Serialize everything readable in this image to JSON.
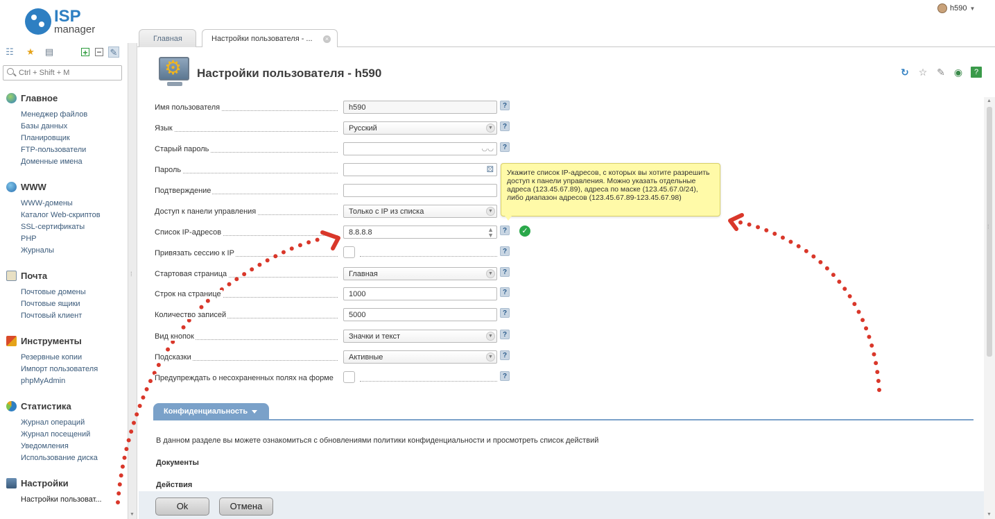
{
  "app": {
    "logo_isp": "ISP",
    "logo_manager": "manager",
    "user_name": "h590"
  },
  "sidebar": {
    "search_placeholder": "Ctrl + Shift + M",
    "sections": [
      {
        "title": "Главное",
        "icon": "home-globe-icon",
        "items": [
          "Менеджер файлов",
          "Базы данных",
          "Планировщик",
          "FTP-пользователи",
          "Доменные имена"
        ]
      },
      {
        "title": "WWW",
        "icon": "globe-icon",
        "items": [
          "WWW-домены",
          "Каталог Web-скриптов",
          "SSL-сертификаты",
          "PHP",
          "Журналы"
        ]
      },
      {
        "title": "Почта",
        "icon": "mail-icon",
        "items": [
          "Почтовые домены",
          "Почтовые ящики",
          "Почтовый клиент"
        ]
      },
      {
        "title": "Инструменты",
        "icon": "tools-icon",
        "items": [
          "Резервные копии",
          "Импорт пользователя",
          "phpMyAdmin"
        ]
      },
      {
        "title": "Статистика",
        "icon": "stats-icon",
        "items": [
          "Журнал операций",
          "Журнал посещений",
          "Уведомления",
          "Использование диска"
        ]
      },
      {
        "title": "Настройки",
        "icon": "settings-icon",
        "items": [
          "Настройки пользоват..."
        ]
      }
    ]
  },
  "tabs": [
    {
      "label": "Главная"
    },
    {
      "label": "Настройки пользователя - ..."
    }
  ],
  "page": {
    "title": "Настройки пользователя - h590"
  },
  "form": {
    "username": {
      "label": "Имя пользователя",
      "value": "h590"
    },
    "language": {
      "label": "Язык",
      "value": "Русский"
    },
    "old_password": {
      "label": "Старый пароль",
      "value": ""
    },
    "password": {
      "label": "Пароль",
      "value": ""
    },
    "confirm": {
      "label": "Подтверждение",
      "value": ""
    },
    "panel_access": {
      "label": "Доступ к панели управления",
      "value": "Только с IP из списка"
    },
    "ip_list": {
      "label": "Список IP-адресов",
      "value": "8.8.8.8"
    },
    "bind_session": {
      "label": "Привязать сессию к IP",
      "checked": false
    },
    "start_page": {
      "label": "Стартовая страница",
      "value": "Главная"
    },
    "rows_per_page": {
      "label": "Строк на странице",
      "value": "1000"
    },
    "records_count": {
      "label": "Количество записей",
      "value": "5000"
    },
    "button_view": {
      "label": "Вид кнопок",
      "value": "Значки и текст"
    },
    "hints": {
      "label": "Подсказки",
      "value": "Активные"
    },
    "warn_unsaved": {
      "label": "Предупреждать о несохраненных полях на форме",
      "checked": false
    }
  },
  "tooltip": {
    "text": "Укажите список IP-адресов, с которых вы хотите разрешить доступ к панели управления. Можно указать отдельные адреса (123.45.67.89), адреса по маске (123.45.67.0/24), либо диапазон адресов (123.45.67.89-123.45.67.98)"
  },
  "privacy": {
    "tab_label": "Конфиденциальность",
    "description": "В данном разделе вы можете ознакомиться с обновлениями политики конфиденциальности и просмотреть список действий",
    "documents_label": "Документы",
    "actions_label": "Действия"
  },
  "buttons": {
    "ok": "Ok",
    "cancel": "Отмена"
  },
  "colors": {
    "accent": "#7aa1c9",
    "annotation": "#d9372a",
    "tooltip_bg": "#fffaa8",
    "success": "#2aa84a"
  }
}
